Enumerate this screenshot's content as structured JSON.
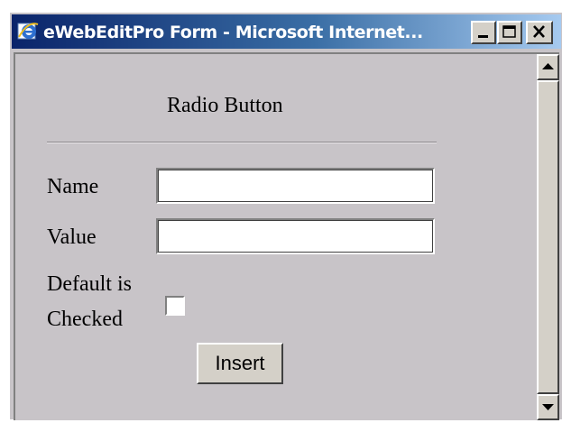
{
  "window": {
    "title": "eWebEditPro Form - Microsoft Internet...",
    "icons": {
      "app": "ie-icon",
      "minimize": "minimize-icon",
      "maximize": "maximize-icon",
      "close": "close-icon",
      "scroll_up": "scroll-up-arrow-icon",
      "scroll_down": "scroll-down-arrow-icon"
    }
  },
  "form": {
    "heading": "Radio Button",
    "name_label": "Name",
    "name_value": "",
    "value_label": "Value",
    "value_value": "",
    "default_label_line1": "Default is",
    "default_label_line2": "Checked",
    "default_checked": false,
    "insert_label": "Insert"
  },
  "colors": {
    "title_gradient_start": "#0a246a",
    "title_gradient_end": "#a6caf0",
    "face": "#c8c4c8"
  }
}
